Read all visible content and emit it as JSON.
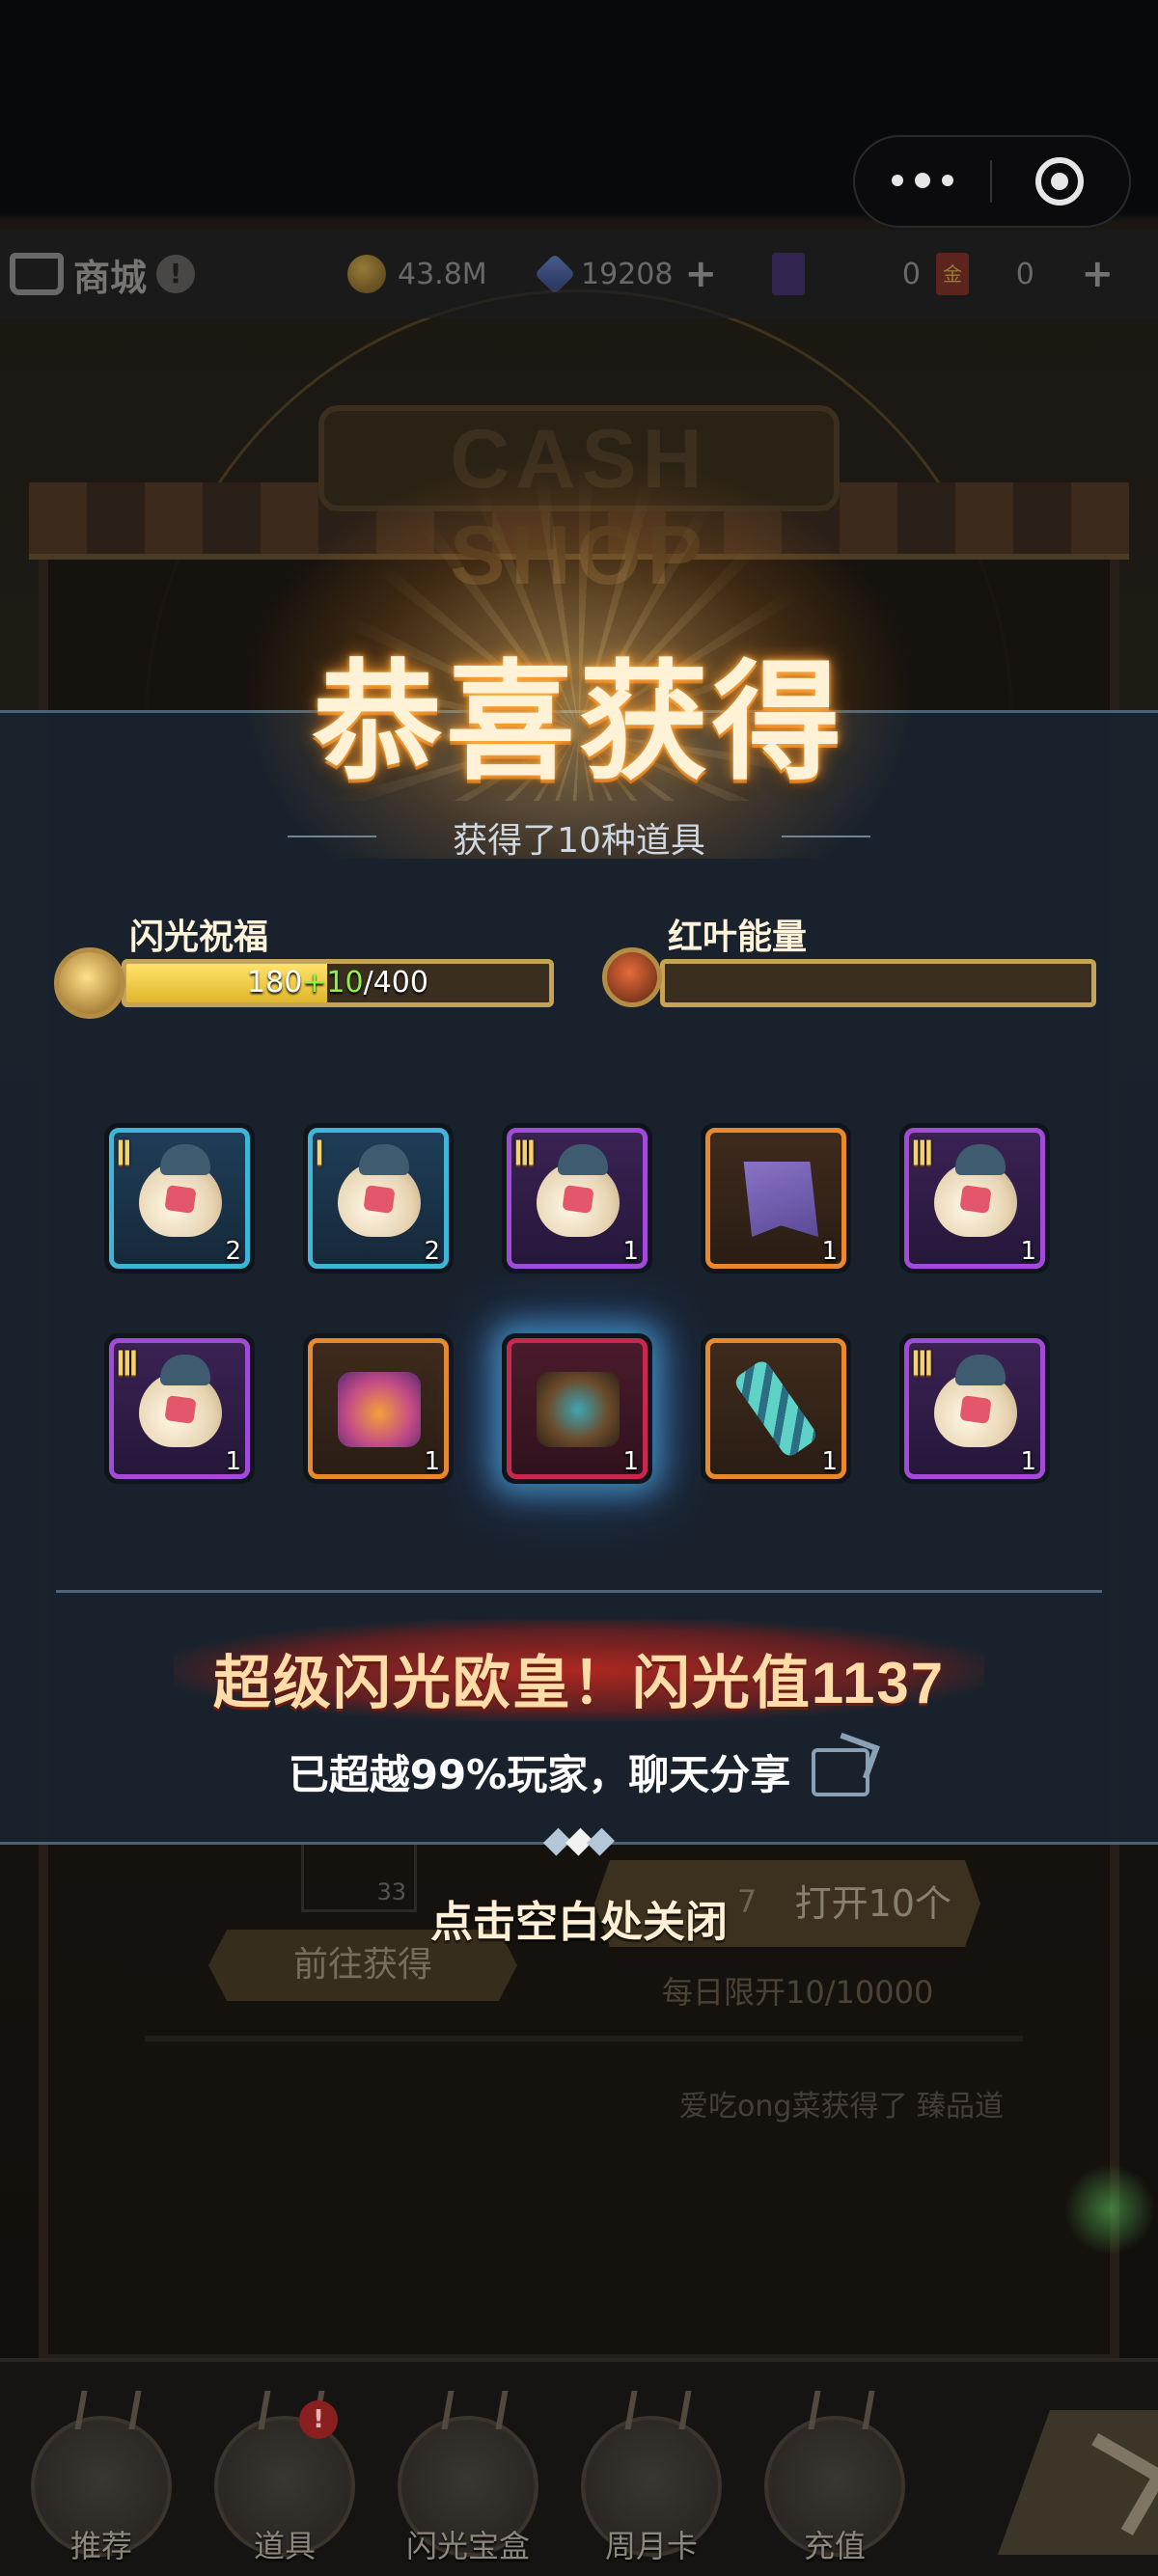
{
  "top_capsule": {
    "more_icon": "more-dots-icon",
    "target_icon": "target-icon"
  },
  "topbar": {
    "shop_title": "商城",
    "gold": "43.8M",
    "gems": "19208",
    "cards": "0",
    "gold_cards": "0",
    "gold_card_glyph": "金"
  },
  "modal": {
    "title": "恭喜获得",
    "subtitle": "获得了10种道具",
    "bars": {
      "flash": {
        "label": "闪光祝福",
        "current": "180",
        "bonus": "+10",
        "max": "/400",
        "fill_fraction": 0.475
      },
      "leaf": {
        "label": "红叶能量",
        "fill_fraction": 0
      }
    },
    "items": [
      {
        "tier": "Ⅱ",
        "count": "2",
        "rarity": "blue",
        "icon": "pouch-icon"
      },
      {
        "tier": "Ⅰ",
        "count": "2",
        "rarity": "blue",
        "icon": "pouch-icon"
      },
      {
        "tier": "Ⅲ",
        "count": "1",
        "rarity": "purple",
        "icon": "pouch-icon"
      },
      {
        "tier": "",
        "count": "1",
        "rarity": "orange",
        "icon": "banner-flag-icon"
      },
      {
        "tier": "Ⅲ",
        "count": "1",
        "rarity": "purple",
        "icon": "pouch-icon"
      },
      {
        "tier": "Ⅲ",
        "count": "1",
        "rarity": "purple",
        "icon": "pouch-icon"
      },
      {
        "tier": "",
        "count": "1",
        "rarity": "orange",
        "icon": "pink-chest-icon"
      },
      {
        "tier": "",
        "count": "1",
        "rarity": "red",
        "icon": "gold-chest-icon"
      },
      {
        "tier": "",
        "count": "1",
        "rarity": "orange",
        "icon": "chain-icon"
      },
      {
        "tier": "Ⅲ",
        "count": "1",
        "rarity": "purple",
        "icon": "pouch-icon"
      }
    ],
    "banner": "超级闪光欧皇！闪光值1137",
    "share_text": "已超越99%玩家，聊天分享",
    "close_hint": "点击空白处关闭"
  },
  "background": {
    "sign": "CASH SHOP",
    "slot_count": "33",
    "open10": "打开10个",
    "open10_prefix": "7",
    "goto": "前往获得",
    "daily_limit": "每日限开10/10000",
    "ticker": "爱吃ong菜获得了 臻品道"
  },
  "nav": [
    {
      "label": "推荐",
      "badge": ""
    },
    {
      "label": "道具",
      "badge": "!"
    },
    {
      "label": "闪光宝盒",
      "badge": ""
    },
    {
      "label": "周月卡",
      "badge": ""
    },
    {
      "label": "充值",
      "badge": ""
    }
  ],
  "colors": {
    "rarity_blue": "#3fb6d8",
    "rarity_purple": "#a24bd9",
    "rarity_orange": "#e88a2c",
    "rarity_red": "#c8284e",
    "bonus_green": "#8ef04a"
  }
}
